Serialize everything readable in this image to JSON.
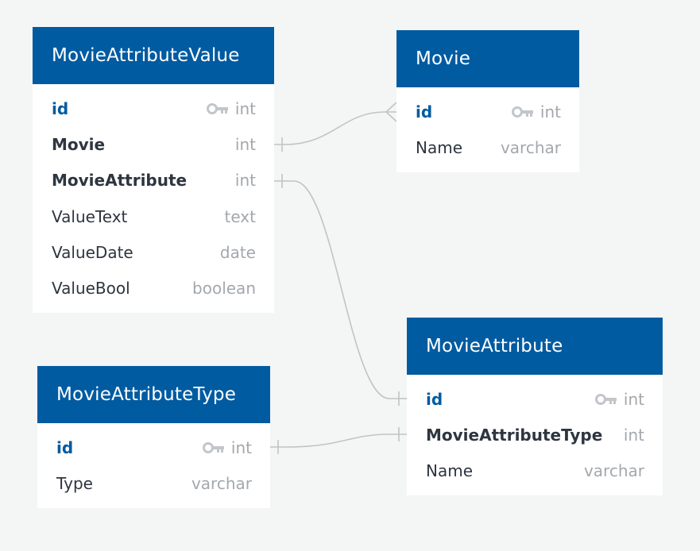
{
  "tables": {
    "movie_attribute_value": {
      "title": "MovieAttributeValue",
      "fields": [
        {
          "name": "id",
          "type": "int",
          "pk": true,
          "fk": false
        },
        {
          "name": "Movie",
          "type": "int",
          "pk": false,
          "fk": true
        },
        {
          "name": "MovieAttribute",
          "type": "int",
          "pk": false,
          "fk": true
        },
        {
          "name": "ValueText",
          "type": "text",
          "pk": false,
          "fk": false
        },
        {
          "name": "ValueDate",
          "type": "date",
          "pk": false,
          "fk": false
        },
        {
          "name": "ValueBool",
          "type": "boolean",
          "pk": false,
          "fk": false
        }
      ]
    },
    "movie": {
      "title": "Movie",
      "fields": [
        {
          "name": "id",
          "type": "int",
          "pk": true,
          "fk": false
        },
        {
          "name": "Name",
          "type": "varchar",
          "pk": false,
          "fk": false
        }
      ]
    },
    "movie_attribute_type": {
      "title": "MovieAttributeType",
      "fields": [
        {
          "name": "id",
          "type": "int",
          "pk": true,
          "fk": false
        },
        {
          "name": "Type",
          "type": "varchar",
          "pk": false,
          "fk": false
        }
      ]
    },
    "movie_attribute": {
      "title": "MovieAttribute",
      "fields": [
        {
          "name": "id",
          "type": "int",
          "pk": true,
          "fk": false
        },
        {
          "name": "MovieAttributeType",
          "type": "int",
          "pk": false,
          "fk": true
        },
        {
          "name": "Name",
          "type": "varchar",
          "pk": false,
          "fk": false
        }
      ]
    }
  },
  "relations": [
    {
      "from": "MovieAttributeValue.Movie",
      "from_cardinality": "one",
      "to": "Movie.id",
      "to_cardinality": "many"
    },
    {
      "from": "MovieAttributeValue.MovieAttribute",
      "from_cardinality": "one",
      "to": "MovieAttribute.id",
      "to_cardinality": "one"
    },
    {
      "from": "MovieAttributeType.id",
      "from_cardinality": "one",
      "to": "MovieAttribute.MovieAttributeType",
      "to_cardinality": "one"
    }
  ],
  "colors": {
    "header": "#005ba1",
    "primary_key": "#005ba1",
    "field_text": "#2d3540",
    "type_text": "#a3a8ad",
    "connector": "#c2c4c4",
    "background": "#f4f5f5"
  }
}
